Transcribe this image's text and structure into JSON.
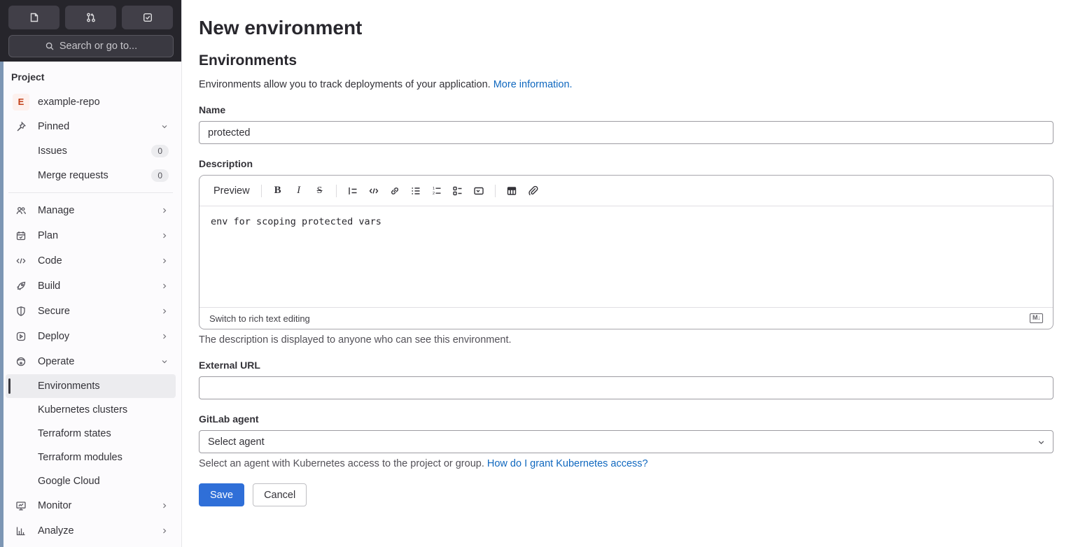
{
  "sidebar": {
    "header_icons": [
      "issues-shortcut-icon",
      "merge-requests-shortcut-icon",
      "todo-list-shortcut-icon"
    ],
    "search_label": "Search or go to...",
    "project_section_label": "Project",
    "project": {
      "avatar_letter": "E",
      "name": "example-repo"
    },
    "pinned_label": "Pinned",
    "pinned_items": [
      {
        "label": "Issues",
        "badge": "0"
      },
      {
        "label": "Merge requests",
        "badge": "0"
      }
    ],
    "nav_items": [
      {
        "label": "Manage"
      },
      {
        "label": "Plan"
      },
      {
        "label": "Code"
      },
      {
        "label": "Build"
      },
      {
        "label": "Secure"
      },
      {
        "label": "Deploy"
      },
      {
        "label": "Operate"
      }
    ],
    "operate_children": [
      {
        "label": "Environments",
        "active": true
      },
      {
        "label": "Kubernetes clusters"
      },
      {
        "label": "Terraform states"
      },
      {
        "label": "Terraform modules"
      },
      {
        "label": "Google Cloud"
      }
    ],
    "bottom_items": [
      {
        "label": "Monitor"
      },
      {
        "label": "Analyze"
      }
    ]
  },
  "main": {
    "page_title": "New environment",
    "section_title": "Environments",
    "intro_text": "Environments allow you to track deployments of your application.",
    "intro_link": "More information.",
    "name": {
      "label": "Name",
      "value": "protected"
    },
    "description": {
      "label": "Description",
      "preview_label": "Preview",
      "toolbar_icons": [
        "bold",
        "italic",
        "strikethrough",
        "quote",
        "code",
        "link",
        "bullet-list",
        "numbered-list",
        "task-list",
        "collapsible-section",
        "table",
        "attach"
      ],
      "value": "env for scoping protected vars",
      "switch_link": "Switch to rich text editing",
      "markdown_badge": "M↓",
      "help": "The description is displayed to anyone who can see this environment."
    },
    "external_url": {
      "label": "External URL",
      "value": ""
    },
    "agent": {
      "label": "GitLab agent",
      "selected": "Select agent",
      "help": "Select an agent with Kubernetes access to the project or group.",
      "help_link": "How do I grant Kubernetes access?"
    },
    "actions": {
      "save": "Save",
      "cancel": "Cancel"
    }
  },
  "colors": {
    "primary_button": "#2f6fd8",
    "link": "#1068bf",
    "sidebar_header_bg": "#26252b",
    "active_item_bg": "#ececef",
    "edge_strip": "#7d96b4",
    "avatar_bg": "#fdf1ee",
    "avatar_text": "#c24018"
  }
}
